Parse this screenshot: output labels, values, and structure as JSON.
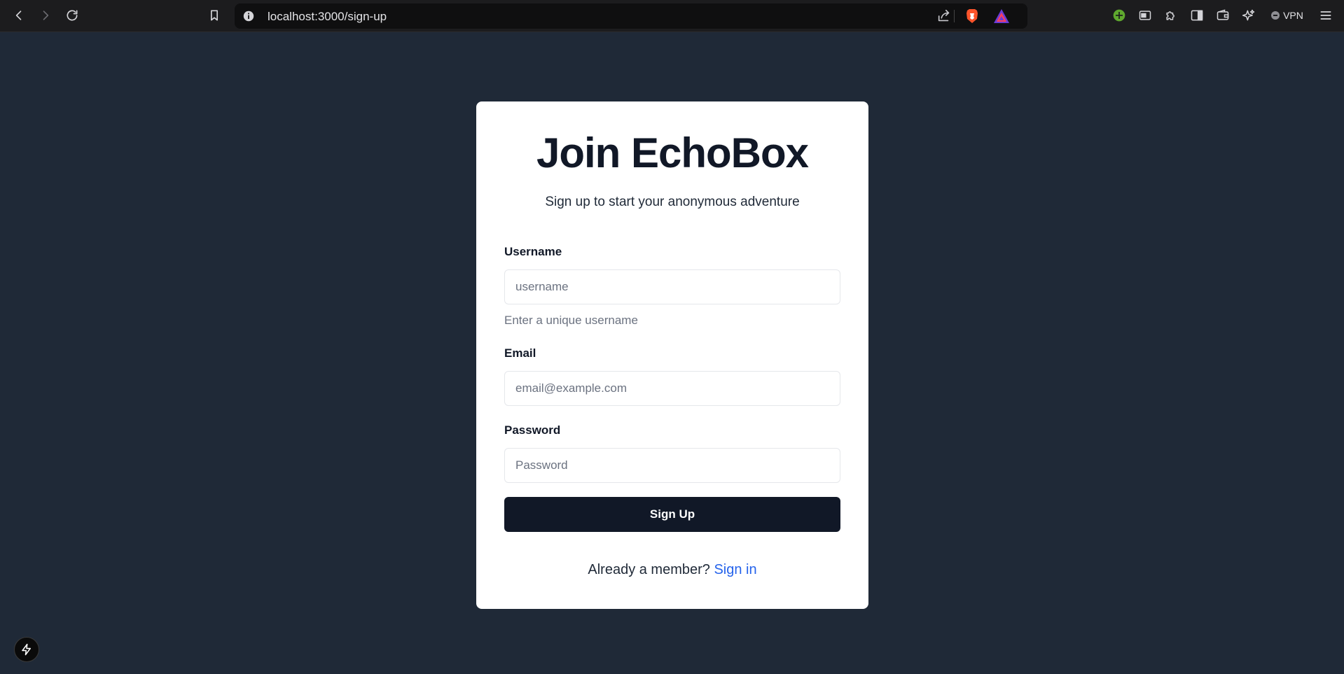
{
  "browser": {
    "url": "localhost:3000/sign-up",
    "vpn_label": "VPN",
    "icons": {
      "back": "back-arrow-icon",
      "forward": "forward-arrow-icon",
      "reload": "reload-icon",
      "bookmark": "bookmark-icon",
      "site_info": "info-icon",
      "share": "share-icon",
      "brave_shields": "brave-shields-icon",
      "brave_rewards": "brave-rewards-icon",
      "extension_green": "add-extension-icon",
      "tab_view": "tab-view-icon",
      "extensions": "puzzle-icon",
      "sidebar": "sidebar-icon",
      "wallet": "wallet-icon",
      "leo": "ai-sparkle-icon",
      "menu": "hamburger-menu-icon"
    }
  },
  "form": {
    "title": "Join EchoBox",
    "subtitle": "Sign up to start your anonymous adventure",
    "username": {
      "label": "Username",
      "placeholder": "username",
      "value": "",
      "hint": "Enter a unique username"
    },
    "email": {
      "label": "Email",
      "placeholder": "email@example.com",
      "value": ""
    },
    "password": {
      "label": "Password",
      "placeholder": "Password",
      "value": ""
    },
    "submit_label": "Sign Up",
    "footer_text": "Already a member?",
    "signin_link": "Sign in"
  },
  "colors": {
    "page_background": "#1f2937",
    "card_background": "#ffffff",
    "primary_button": "#111827",
    "link": "#2563eb"
  }
}
